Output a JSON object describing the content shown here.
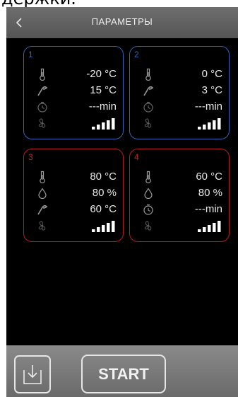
{
  "cropped_top_text": "держки.",
  "header": {
    "title": "ПАРАМЕТРЫ",
    "back_icon": "chevron-left-icon"
  },
  "programs": [
    {
      "number": "1",
      "border_color": "#2f66b3",
      "rows": [
        {
          "icon": "thermometer-icon",
          "value": "-20 °C"
        },
        {
          "icon": "core-probe-icon",
          "value": "15 °C"
        },
        {
          "icon": "timer-icon",
          "value": "---min"
        },
        {
          "icon": "fan-icon",
          "level": "5/5"
        }
      ]
    },
    {
      "number": "2",
      "border_color": "#2f66b3",
      "rows": [
        {
          "icon": "thermometer-icon",
          "value": "0 °C"
        },
        {
          "icon": "core-probe-icon",
          "value": "3 °C"
        },
        {
          "icon": "timer-icon",
          "value": "---min"
        },
        {
          "icon": "fan-icon",
          "level": "5/5"
        }
      ]
    },
    {
      "number": "3",
      "border_color": "#b51e1e",
      "rows": [
        {
          "icon": "thermometer-icon",
          "value": "80 °C"
        },
        {
          "icon": "humidity-drop-icon",
          "value": "80 %"
        },
        {
          "icon": "core-probe-icon",
          "value": "60 °C"
        },
        {
          "icon": "fan-icon",
          "level": "5/5"
        }
      ]
    },
    {
      "number": "4",
      "border_color": "#b51e1e",
      "rows": [
        {
          "icon": "thermometer-icon",
          "value": "60 °C"
        },
        {
          "icon": "humidity-drop-icon",
          "value": "80 %"
        },
        {
          "icon": "timer-icon",
          "value": "---min"
        },
        {
          "icon": "fan-icon",
          "level": "5/5"
        }
      ]
    }
  ],
  "footer": {
    "save_icon": "save-download-icon",
    "start_label": "START"
  }
}
